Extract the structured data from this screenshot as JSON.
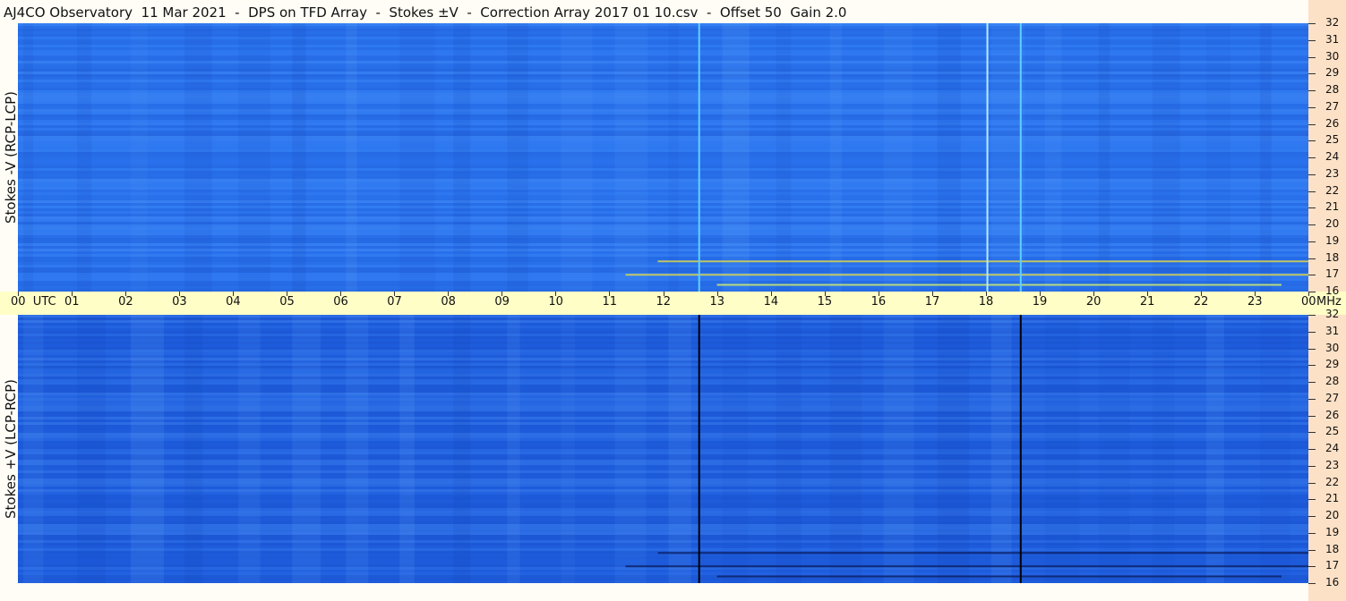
{
  "title": "AJ4CO Observatory  11 Mar 2021  -  DPS on TFD Array  -  Stokes ±V  -  Correction Array 2017 01 10.csv  -  Offset 50  Gain 2.0",
  "chart_data": [
    {
      "type": "heatmap",
      "name": "Stokes -V",
      "ylabel": "Stokes -V (RCP-LCP)",
      "x_range_utc_hours": [
        0,
        24
      ],
      "y_range_mhz": [
        16,
        32
      ],
      "base_color": "#2a74f0",
      "vertical_lines": [
        {
          "utc": 12.67,
          "color": "#5fd0ff"
        },
        {
          "utc": 18.03,
          "color": "#b7eaff"
        },
        {
          "utc": 18.65,
          "color": "#5fd0ff"
        }
      ],
      "bursts": [
        {
          "utc_start": 11.3,
          "utc_end": 24.0,
          "mhz": 17.0,
          "color": "#f2e23a"
        },
        {
          "utc_start": 11.9,
          "utc_end": 24.0,
          "mhz": 17.8,
          "color": "#f2e23a"
        },
        {
          "utc_start": 13.0,
          "utc_end": 23.5,
          "mhz": 16.4,
          "color": "#e8ff5a"
        }
      ]
    },
    {
      "type": "heatmap",
      "name": "Stokes +V",
      "ylabel": "Stokes +V (LCP-RCP)",
      "x_range_utc_hours": [
        0,
        24
      ],
      "y_range_mhz": [
        16,
        32
      ],
      "base_color": "#1f5fe0",
      "vertical_lines": [
        {
          "utc": 12.67,
          "color": "#000000"
        },
        {
          "utc": 18.65,
          "color": "#000000"
        }
      ],
      "bursts": [
        {
          "utc_start": 11.3,
          "utc_end": 24.0,
          "mhz": 17.0,
          "color": "#0a1a5a"
        },
        {
          "utc_start": 11.9,
          "utc_end": 24.0,
          "mhz": 17.8,
          "color": "#0a1a5a"
        },
        {
          "utc_start": 13.0,
          "utc_end": 23.5,
          "mhz": 16.4,
          "color": "#0a1a5a"
        }
      ]
    }
  ],
  "x_ticks": [
    "00  UTC",
    "01",
    "02",
    "03",
    "04",
    "05",
    "06",
    "07",
    "08",
    "09",
    "10",
    "11",
    "12",
    "13",
    "14",
    "15",
    "16",
    "17",
    "18",
    "19",
    "20",
    "21",
    "22",
    "23",
    "00"
  ],
  "y_ticks": [
    "32",
    "31",
    "30",
    "29",
    "28",
    "27",
    "26",
    "25",
    "24",
    "23",
    "22",
    "21",
    "20",
    "19",
    "18",
    "17",
    "16"
  ],
  "freq_unit": "MHz"
}
